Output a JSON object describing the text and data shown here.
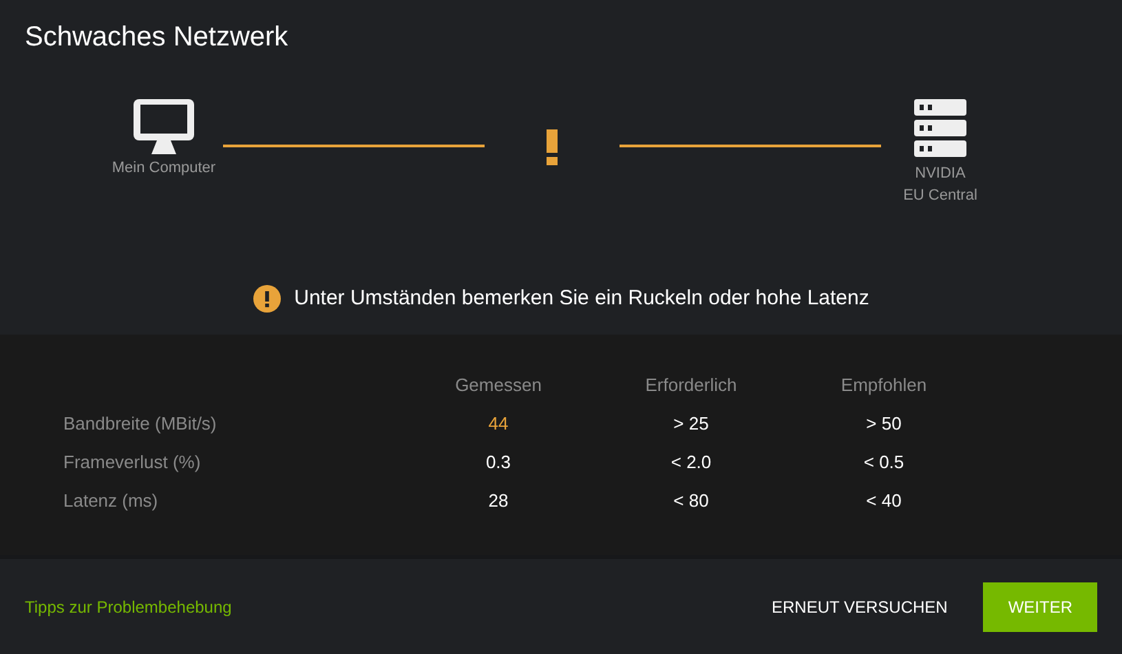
{
  "title": "Schwaches Netzwerk",
  "diagram": {
    "source": "Mein Computer",
    "target_lines": [
      "NVIDIA",
      "EU Central"
    ],
    "warning": true
  },
  "notice": "Unter Umständen bemerken Sie ein Ruckeln oder hohe Latenz",
  "table": {
    "columns": [
      "Gemessen",
      "Erforderlich",
      "Empfohlen"
    ],
    "rows": [
      {
        "label": "Bandbreite (MBit/s)",
        "cells": [
          {
            "text": "44",
            "warning": true
          },
          {
            "text": "> 25",
            "warning": false
          },
          {
            "text": "> 50",
            "warning": false
          }
        ]
      },
      {
        "label": "Frameverlust (%)",
        "cells": [
          {
            "text": "0.3",
            "warning": false
          },
          {
            "text": "< 2.0",
            "warning": false
          },
          {
            "text": "< 0.5",
            "warning": false
          }
        ]
      },
      {
        "label": "Latenz (ms)",
        "cells": [
          {
            "text": "28",
            "warning": false
          },
          {
            "text": "< 80",
            "warning": false
          },
          {
            "text": "< 40",
            "warning": false
          }
        ]
      }
    ]
  },
  "footer": {
    "link": "Tipps zur Problembehebung",
    "buttons": [
      {
        "label": "ERNEUT VERSUCHEN",
        "kind": "text"
      },
      {
        "label": "WEITER",
        "kind": "primary"
      }
    ]
  }
}
